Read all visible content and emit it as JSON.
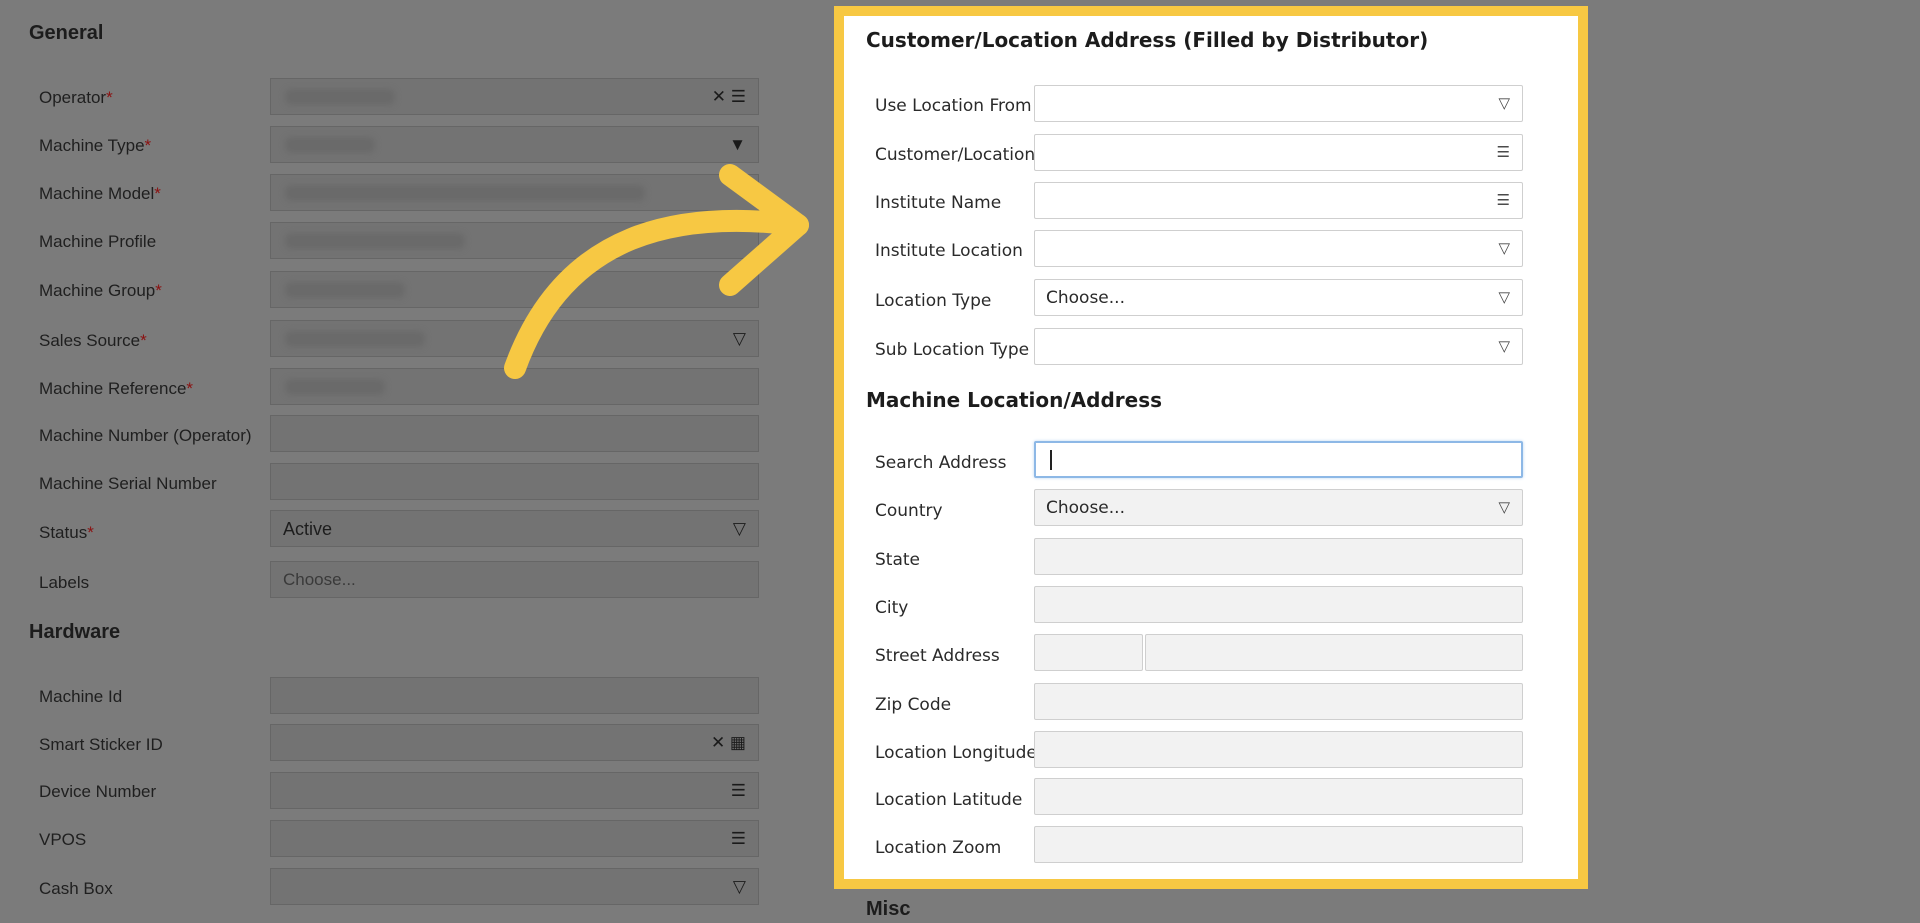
{
  "general": {
    "title": "General",
    "fields": [
      {
        "label": "Operator",
        "required": true,
        "icon": "✕ ☰"
      },
      {
        "label": "Machine Type",
        "required": true,
        "icon": "▼"
      },
      {
        "label": "Machine Model",
        "required": true,
        "icon": ""
      },
      {
        "label": "Machine Profile",
        "required": false,
        "icon": ""
      },
      {
        "label": "Machine Group",
        "required": true,
        "icon": ""
      },
      {
        "label": "Sales Source",
        "required": true,
        "icon": "▽"
      },
      {
        "label": "Machine Reference",
        "required": true,
        "icon": ""
      },
      {
        "label": "Machine Number (Operator)",
        "required": false,
        "icon": ""
      },
      {
        "label": "Machine Serial Number",
        "required": false,
        "icon": ""
      },
      {
        "label": "Status",
        "required": true,
        "value": "Active",
        "icon": "▽"
      },
      {
        "label": "Labels",
        "required": false,
        "placeholder": "Choose...",
        "icon": ""
      }
    ]
  },
  "hardware": {
    "title": "Hardware",
    "fields": [
      {
        "label": "Machine Id",
        "icon": ""
      },
      {
        "label": "Smart Sticker ID",
        "icon": "✕ ▦"
      },
      {
        "label": "Device Number",
        "icon": "☰"
      },
      {
        "label": "VPOS",
        "icon": "☰"
      },
      {
        "label": "Cash Box",
        "icon": "▽"
      }
    ]
  },
  "customer": {
    "title": "Customer/Location Address (Filled by Distributor)",
    "fields": [
      {
        "label": "Use Location From",
        "value": "",
        "icon": "▽"
      },
      {
        "label": "Customer/Location",
        "value": "",
        "icon": "☰"
      },
      {
        "label": "Institute Name",
        "value": "",
        "icon": "☰"
      },
      {
        "label": "Institute Location",
        "value": "",
        "icon": "▽"
      },
      {
        "label": "Location Type",
        "value": "Choose...",
        "icon": "▽"
      },
      {
        "label": "Sub Location Type",
        "value": "",
        "icon": "▽"
      }
    ]
  },
  "machine_location": {
    "title": "Machine Location/Address",
    "fields": [
      {
        "label": "Search Address"
      },
      {
        "label": "Country",
        "value": "Choose...",
        "icon": "▽"
      },
      {
        "label": "State"
      },
      {
        "label": "City"
      },
      {
        "label": "Street Address"
      },
      {
        "label": "Zip Code"
      },
      {
        "label": "Location Longitude"
      },
      {
        "label": "Location Latitude"
      },
      {
        "label": "Location Zoom"
      }
    ]
  },
  "misc": {
    "title": "Misc"
  },
  "colors": {
    "highlight": "#f7c843",
    "arrow": "#f7c843",
    "overlay": "#7b7b7b"
  }
}
